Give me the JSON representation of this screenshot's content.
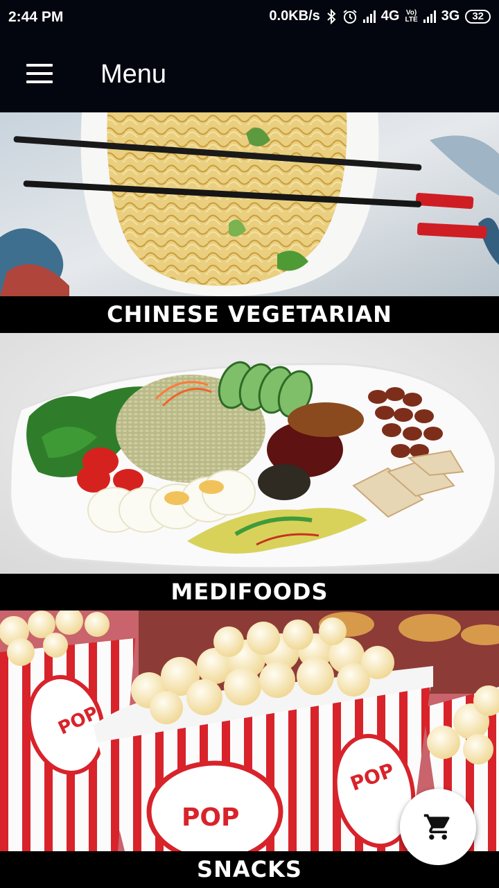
{
  "status_bar": {
    "time": "2:44 PM",
    "network_speed": "0.0KB/s",
    "network1": "4G",
    "network2": "3G",
    "volte": "Vo)) LTE",
    "battery": "32"
  },
  "app_bar": {
    "title": "Menu",
    "menu_icon": "hamburger-icon"
  },
  "categories": [
    {
      "label": "CHINESE VEGETARIAN",
      "image": "noodles-bowl-with-chopsticks"
    },
    {
      "label": "MEDIFOODS",
      "image": "rice-plate-with-vegetables"
    },
    {
      "label": "SNACKS",
      "image": "popcorn-boxes"
    }
  ],
  "fab": {
    "icon": "cart-icon"
  }
}
